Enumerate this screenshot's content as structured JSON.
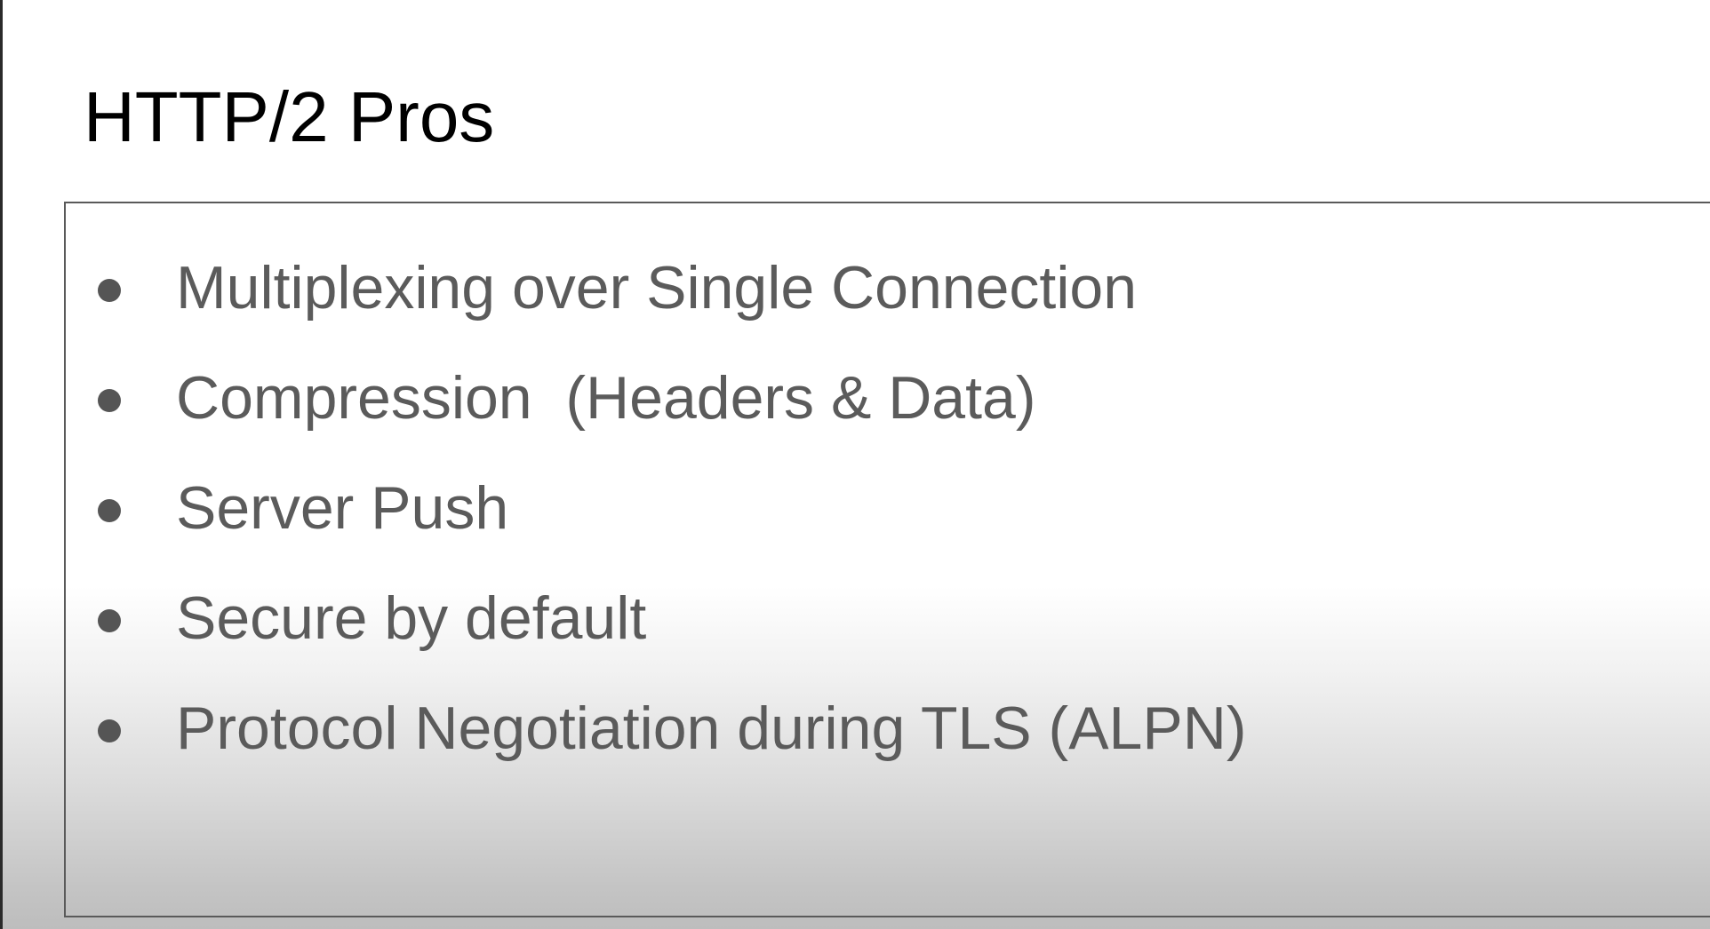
{
  "slide": {
    "title": "HTTP/2 Pros",
    "bullets": [
      {
        "text": "Multiplexing over Single Connection"
      },
      {
        "text": "Compression  (Headers & Data)"
      },
      {
        "text": "Server Push"
      },
      {
        "text": "Secure by default"
      },
      {
        "text": "Protocol Negotiation during TLS (ALPN)"
      }
    ]
  },
  "colors": {
    "title": "#000000",
    "bullet_text": "#5b5b5b",
    "bullet_dot": "#555555",
    "box_border": "#5a5a5a"
  }
}
